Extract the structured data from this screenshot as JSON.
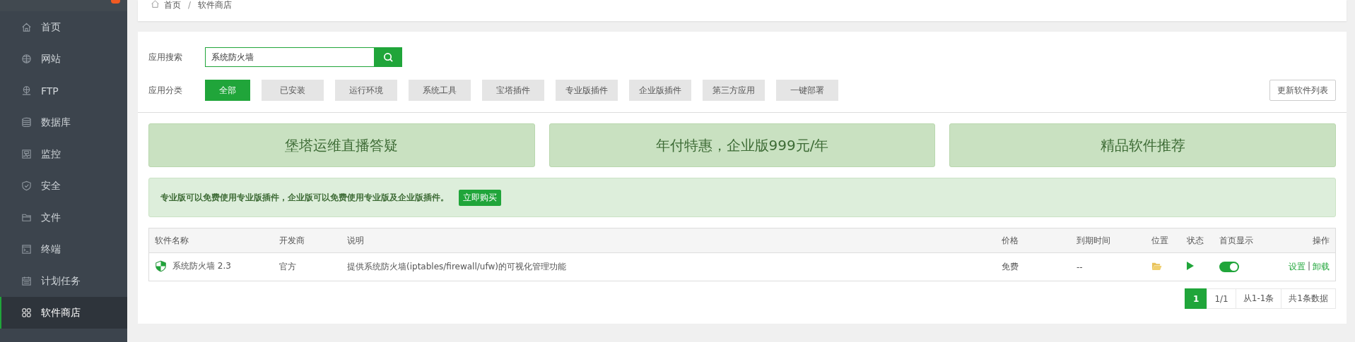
{
  "sidebar": {
    "items": [
      {
        "label": "首页",
        "kind": "home",
        "selected": false
      },
      {
        "label": "网站",
        "kind": "globe",
        "selected": false
      },
      {
        "label": "FTP",
        "kind": "ftp",
        "selected": false
      },
      {
        "label": "数据库",
        "kind": "db",
        "selected": false
      },
      {
        "label": "监控",
        "kind": "monitor",
        "selected": false
      },
      {
        "label": "安全",
        "kind": "shield",
        "selected": false
      },
      {
        "label": "文件",
        "kind": "folder",
        "selected": false
      },
      {
        "label": "终端",
        "kind": "terminal",
        "selected": false
      },
      {
        "label": "计划任务",
        "kind": "calendar",
        "selected": false
      },
      {
        "label": "软件商店",
        "kind": "grid",
        "selected": true
      }
    ]
  },
  "breadcrumb": {
    "items": [
      "首页",
      "软件商店"
    ],
    "separator": "/"
  },
  "search": {
    "label": "应用搜索",
    "value": "系统防火墙"
  },
  "categories": {
    "label": "应用分类",
    "items": [
      {
        "label": "全部",
        "selected": true
      },
      {
        "label": "已安装",
        "selected": false
      },
      {
        "label": "运行环境",
        "selected": false
      },
      {
        "label": "系统工具",
        "selected": false
      },
      {
        "label": "宝塔插件",
        "selected": false
      },
      {
        "label": "专业版插件",
        "selected": false
      },
      {
        "label": "企业版插件",
        "selected": false
      },
      {
        "label": "第三方应用",
        "selected": false
      },
      {
        "label": "一键部署",
        "selected": false
      }
    ]
  },
  "refresh_button": "更新软件列表",
  "banners": [
    "堡塔运维直播答疑",
    "年付特惠，企业版999元/年",
    "精品软件推荐"
  ],
  "notice": {
    "text": "专业版可以免费使用专业版插件，企业版可以免费使用专业版及企业版插件。",
    "button": "立即购买"
  },
  "table": {
    "columns": [
      "软件名称",
      "开发商",
      "说明",
      "价格",
      "到期时间",
      "位置",
      "状态",
      "首页显示",
      "操作"
    ],
    "rows": [
      {
        "name": "系统防火墙 2.3",
        "developer": "官方",
        "description": "提供系统防火墙(iptables/firewall/ufw)的可视化管理功能",
        "price": "免费",
        "expiry": "--",
        "running": true,
        "home_display": true,
        "actions": [
          "设置",
          "卸载"
        ],
        "separator": "|"
      }
    ]
  },
  "pagination": [
    {
      "label": "1",
      "selected": true
    },
    {
      "label": "1/1",
      "selected": false
    },
    {
      "label": "从1-1条",
      "selected": false
    },
    {
      "label": "共1条数据",
      "selected": false
    }
  ]
}
